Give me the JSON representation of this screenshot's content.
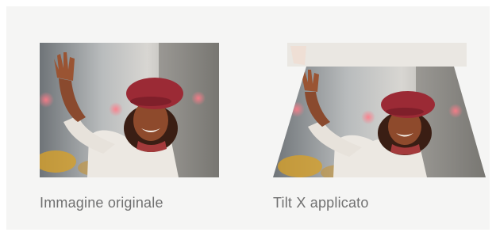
{
  "captions": {
    "original": "Immagine originale",
    "tilted": "Tilt X applicato"
  },
  "images": {
    "original": {
      "icon": "photo-woman-waving"
    },
    "tilted": {
      "icon": "photo-woman-waving-tilt-x"
    }
  },
  "colors": {
    "panel_background": "#f5f5f4",
    "caption_text": "#707070",
    "beret": "#9b2a35",
    "coat": "#ece8e2"
  }
}
